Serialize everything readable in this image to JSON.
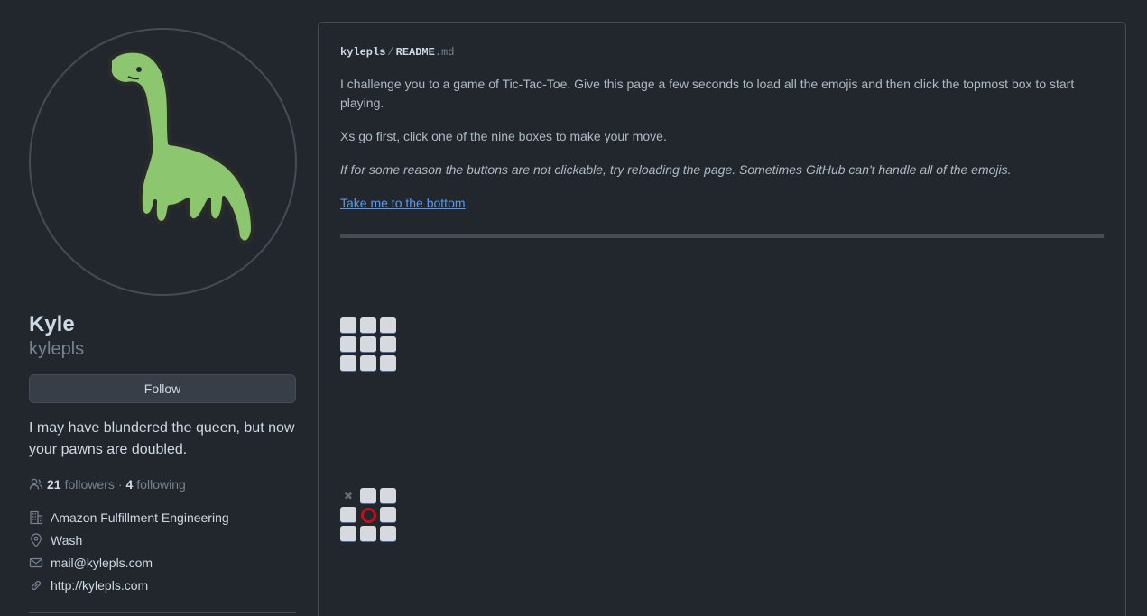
{
  "profile": {
    "avatar_icon": "green-dinosaur-avatar",
    "name": "Kyle",
    "login": "kylepls",
    "follow_label": "Follow",
    "bio": "I may have blundered the queen, but now your pawns are doubled.",
    "followers_count": "21",
    "followers_label": "followers",
    "following_count": "4",
    "following_label": "following",
    "separator": "·",
    "company": "Amazon Fulfillment Engineering",
    "location": "Wash",
    "email": "mail@kylepls.com",
    "website": "http://kylepls.com"
  },
  "readme": {
    "path_user": "kylepls",
    "path_sep": "/",
    "path_file": "README",
    "path_ext": ".md",
    "para1": "I challenge you to a game of Tic-Tac-Toe. Give this page a few seconds to load all the emojis and then click the topmost box to start playing.",
    "para2": "Xs go first, click one of the nine boxes to make your move.",
    "para3": "If for some reason the buttons are not clickable, try reloading the page. Sometimes GitHub can't handle all of the emojis.",
    "bottom_link": "Take me to the bottom"
  },
  "boards": [
    {
      "cells": [
        "",
        "",
        "",
        "",
        "",
        "",
        "",
        "",
        ""
      ]
    },
    {
      "cells": [
        "X",
        "",
        "",
        "",
        "O",
        "",
        "",
        "",
        ""
      ]
    }
  ],
  "colors": {
    "background": "#22272e",
    "border": "#444c56",
    "link": "#539bf5",
    "avatar_green": "#8cc770",
    "o_mark": "#c40f1b"
  }
}
